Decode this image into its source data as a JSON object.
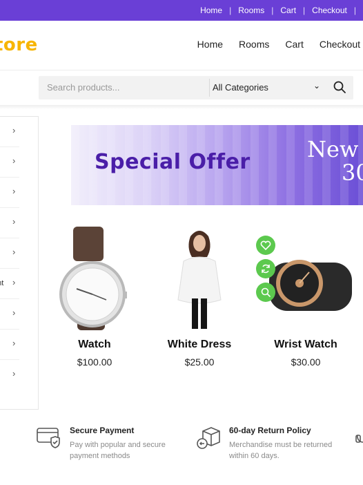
{
  "topbar": {
    "links": [
      "Home",
      "Rooms",
      "Cart",
      "Checkout"
    ]
  },
  "header": {
    "logo": "tore",
    "nav": [
      "Home",
      "Rooms",
      "Cart",
      "Checkout"
    ]
  },
  "search": {
    "placeholder": "Search products...",
    "category": "All Categories"
  },
  "sidebar": {
    "items": [
      "",
      "",
      "",
      "",
      "",
      "ent",
      "",
      "",
      ""
    ]
  },
  "banner": {
    "title": "Special Offer",
    "line1": "New Y",
    "line2": "30"
  },
  "products": [
    {
      "name": "Watch",
      "price": "$100.00"
    },
    {
      "name": "White Dress",
      "price": "$25.00"
    },
    {
      "name": "Wrist Watch",
      "price": "$30.00"
    }
  ],
  "features": [
    {
      "title": "Secure Payment",
      "desc": "Pay with popular and secure payment methods",
      "icon": "credit-card-shield-icon"
    },
    {
      "title": "60-day Return Policy",
      "desc": "Merchandise must be returned within 60 days.",
      "icon": "return-box-icon"
    }
  ],
  "colors": {
    "topbar": "#6a3fd6",
    "logo": "#f7b500",
    "banner_title": "#4a1ea8",
    "action_button": "#5cc94e"
  }
}
